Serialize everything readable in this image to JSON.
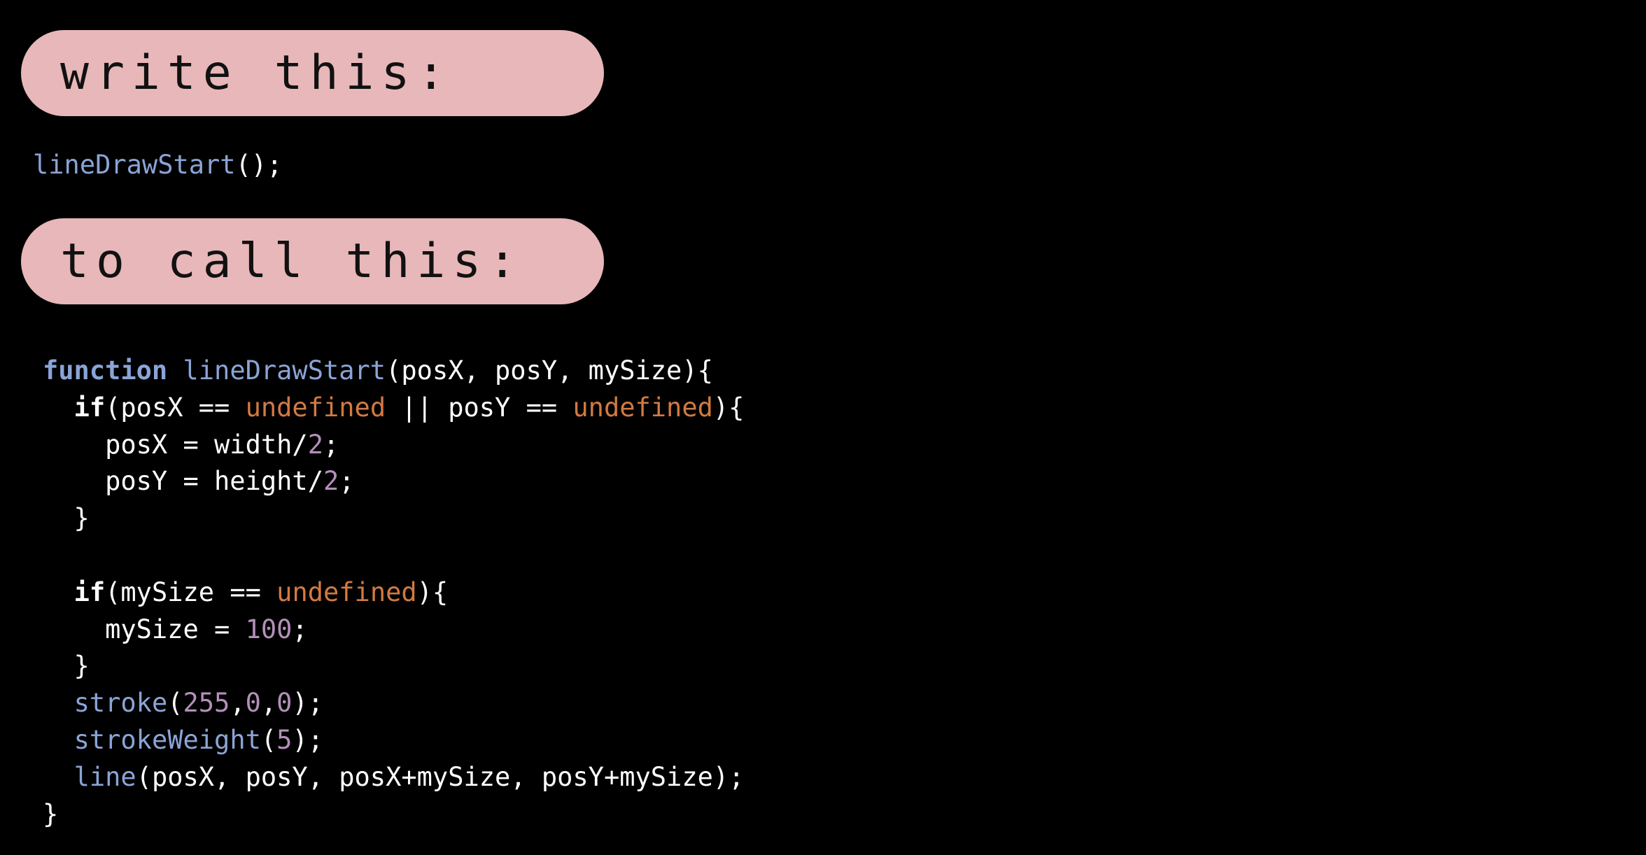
{
  "labels": {
    "write": "write this:",
    "call": "to call this:"
  },
  "call_statement": [
    {
      "text": "lineDrawStart",
      "kind": "fn"
    },
    {
      "text": "();",
      "kind": "plain"
    }
  ],
  "code": [
    [
      {
        "text": "function",
        "kind": "kw"
      },
      {
        "text": " ",
        "kind": "plain"
      },
      {
        "text": "lineDrawStart",
        "kind": "fn"
      },
      {
        "text": "(posX, posY, mySize){",
        "kind": "plain"
      }
    ],
    [
      {
        "text": "  ",
        "kind": "plain"
      },
      {
        "text": "if",
        "kind": "kw2"
      },
      {
        "text": "(posX == ",
        "kind": "plain"
      },
      {
        "text": "undefined",
        "kind": "undef"
      },
      {
        "text": " || posY == ",
        "kind": "plain"
      },
      {
        "text": "undefined",
        "kind": "undef"
      },
      {
        "text": "){",
        "kind": "plain"
      }
    ],
    [
      {
        "text": "    posX = width/",
        "kind": "plain"
      },
      {
        "text": "2",
        "kind": "num"
      },
      {
        "text": ";",
        "kind": "plain"
      }
    ],
    [
      {
        "text": "    posY = height/",
        "kind": "plain"
      },
      {
        "text": "2",
        "kind": "num"
      },
      {
        "text": ";",
        "kind": "plain"
      }
    ],
    [
      {
        "text": "  }",
        "kind": "plain"
      }
    ],
    [
      {
        "text": "",
        "kind": "plain"
      }
    ],
    [
      {
        "text": "  ",
        "kind": "plain"
      },
      {
        "text": "if",
        "kind": "kw2"
      },
      {
        "text": "(mySize == ",
        "kind": "plain"
      },
      {
        "text": "undefined",
        "kind": "undef"
      },
      {
        "text": "){",
        "kind": "plain"
      }
    ],
    [
      {
        "text": "    mySize = ",
        "kind": "plain"
      },
      {
        "text": "100",
        "kind": "num"
      },
      {
        "text": ";",
        "kind": "plain"
      }
    ],
    [
      {
        "text": "  }",
        "kind": "plain"
      }
    ],
    [
      {
        "text": "  ",
        "kind": "plain"
      },
      {
        "text": "stroke",
        "kind": "fn"
      },
      {
        "text": "(",
        "kind": "plain"
      },
      {
        "text": "255",
        "kind": "num"
      },
      {
        "text": ",",
        "kind": "plain"
      },
      {
        "text": "0",
        "kind": "num"
      },
      {
        "text": ",",
        "kind": "plain"
      },
      {
        "text": "0",
        "kind": "num"
      },
      {
        "text": ");",
        "kind": "plain"
      }
    ],
    [
      {
        "text": "  ",
        "kind": "plain"
      },
      {
        "text": "strokeWeight",
        "kind": "fn"
      },
      {
        "text": "(",
        "kind": "plain"
      },
      {
        "text": "5",
        "kind": "num"
      },
      {
        "text": ");",
        "kind": "plain"
      }
    ],
    [
      {
        "text": "  ",
        "kind": "plain"
      },
      {
        "text": "line",
        "kind": "fn"
      },
      {
        "text": "(posX, posY, posX+mySize, posY+mySize);",
        "kind": "plain"
      }
    ],
    [
      {
        "text": "}",
        "kind": "plain"
      }
    ]
  ],
  "colors": {
    "background": "#000000",
    "pill": "#e8b7b9",
    "keyword": "#8aa4d6",
    "function_name": "#8aa4d6",
    "number": "#b48fba",
    "undefined": "#d27a42",
    "text": "#ffffff"
  }
}
